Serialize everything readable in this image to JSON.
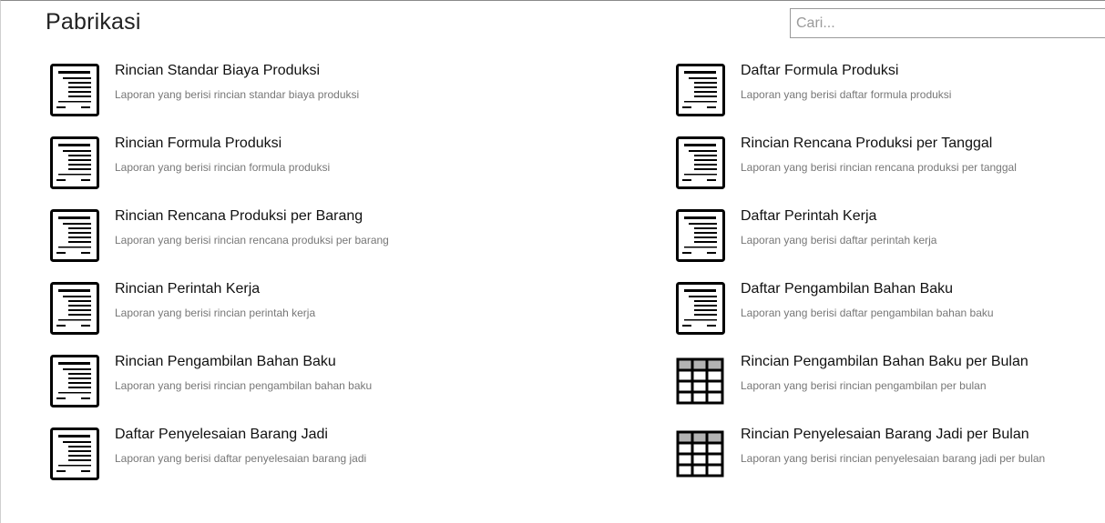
{
  "header": {
    "title": "Pabrikasi",
    "search_placeholder": "Cari..."
  },
  "reports": {
    "left": [
      {
        "title": "Rincian Standar Biaya Produksi",
        "desc": "Laporan yang berisi rincian standar biaya produksi",
        "icon": "document-icon"
      },
      {
        "title": "Rincian Formula Produksi",
        "desc": "Laporan yang berisi rincian formula produksi",
        "icon": "document-icon"
      },
      {
        "title": "Rincian Rencana Produksi per Barang",
        "desc": "Laporan yang berisi rincian rencana produksi per barang",
        "icon": "document-icon"
      },
      {
        "title": "Rincian Perintah Kerja",
        "desc": "Laporan yang berisi rincian perintah kerja",
        "icon": "document-icon"
      },
      {
        "title": "Rincian Pengambilan Bahan Baku",
        "desc": "Laporan yang berisi rincian pengambilan bahan baku",
        "icon": "document-icon"
      },
      {
        "title": "Daftar Penyelesaian Barang Jadi",
        "desc": "Laporan yang berisi daftar penyelesaian barang jadi",
        "icon": "document-icon"
      }
    ],
    "right": [
      {
        "title": "Daftar Formula Produksi",
        "desc": "Laporan yang berisi daftar formula produksi",
        "icon": "document-icon"
      },
      {
        "title": "Rincian Rencana Produksi per Tanggal",
        "desc": "Laporan yang berisi rincian rencana produksi per tanggal",
        "icon": "document-icon"
      },
      {
        "title": "Daftar Perintah Kerja",
        "desc": "Laporan yang berisi daftar perintah kerja",
        "icon": "document-icon"
      },
      {
        "title": "Daftar Pengambilan Bahan Baku",
        "desc": "Laporan yang berisi daftar pengambilan bahan baku",
        "icon": "document-icon"
      },
      {
        "title": "Rincian Pengambilan Bahan Baku per Bulan",
        "desc": "Laporan yang berisi rincian pengambilan per bulan",
        "icon": "grid-table-icon"
      },
      {
        "title": "Rincian Penyelesaian Barang Jadi per Bulan",
        "desc": "Laporan yang berisi rincian penyelesaian barang jadi per bulan",
        "icon": "grid-table-icon"
      }
    ]
  },
  "colors": {
    "icon_stroke": "#000000",
    "grid_header_fill": "#b3b3b3"
  }
}
